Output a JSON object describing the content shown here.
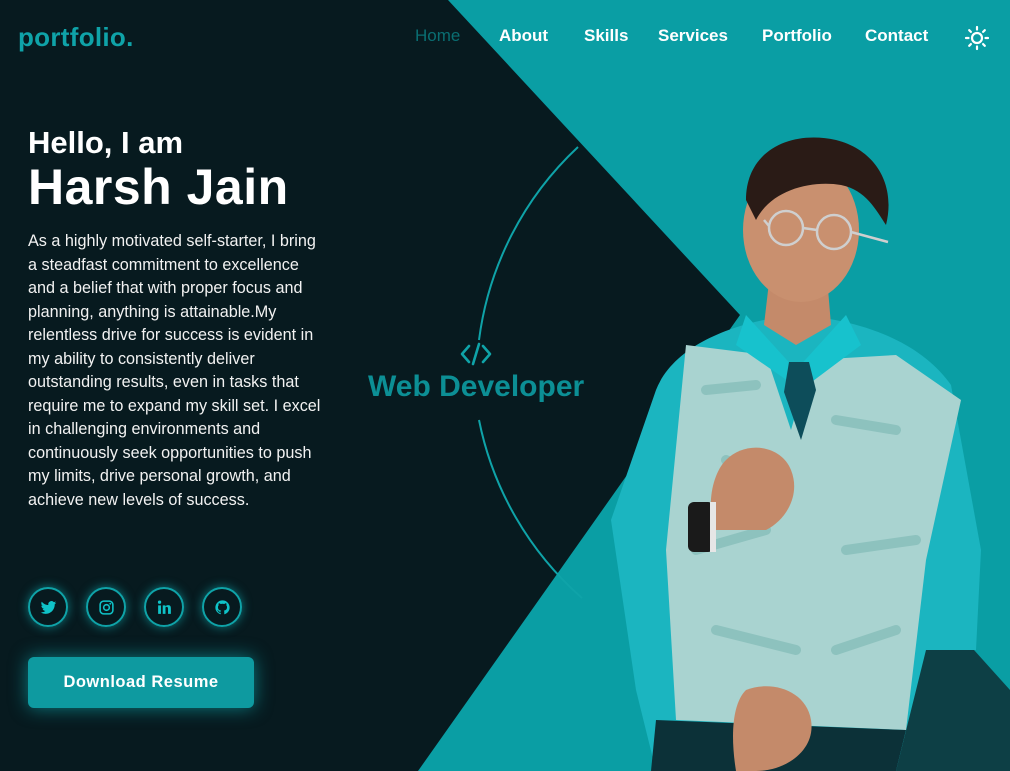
{
  "brand": {
    "logo": "portfolio."
  },
  "nav": {
    "home": "Home",
    "about": "About",
    "skills": "Skills",
    "services": "Services",
    "portfolio": "Portfolio",
    "contact": "Contact"
  },
  "theme_toggle_icon": "sun-icon",
  "hero": {
    "greeting": "Hello, I am",
    "name": "Harsh Jain",
    "bio": "As a highly motivated self-starter, I bring a steadfast commitment to excellence and a belief that with proper focus and planning, anything is attainable.My relentless drive for success is evident in my ability to consistently deliver outstanding results, even in tasks that require me to expand my skill set. I excel in challenging environments and continuously seek opportunities to push my limits, drive personal growth, and achieve new levels of success.",
    "download_button": "Download Resume",
    "role": "Web Developer",
    "role_icon": "code-icon"
  },
  "socials": [
    {
      "icon": "twitter-icon"
    },
    {
      "icon": "instagram-icon"
    },
    {
      "icon": "linkedin-icon"
    },
    {
      "icon": "github-icon"
    }
  ],
  "colors": {
    "background": "#071a1f",
    "accent": "#0fa3a8",
    "accent_dark": "#0a6e72"
  }
}
